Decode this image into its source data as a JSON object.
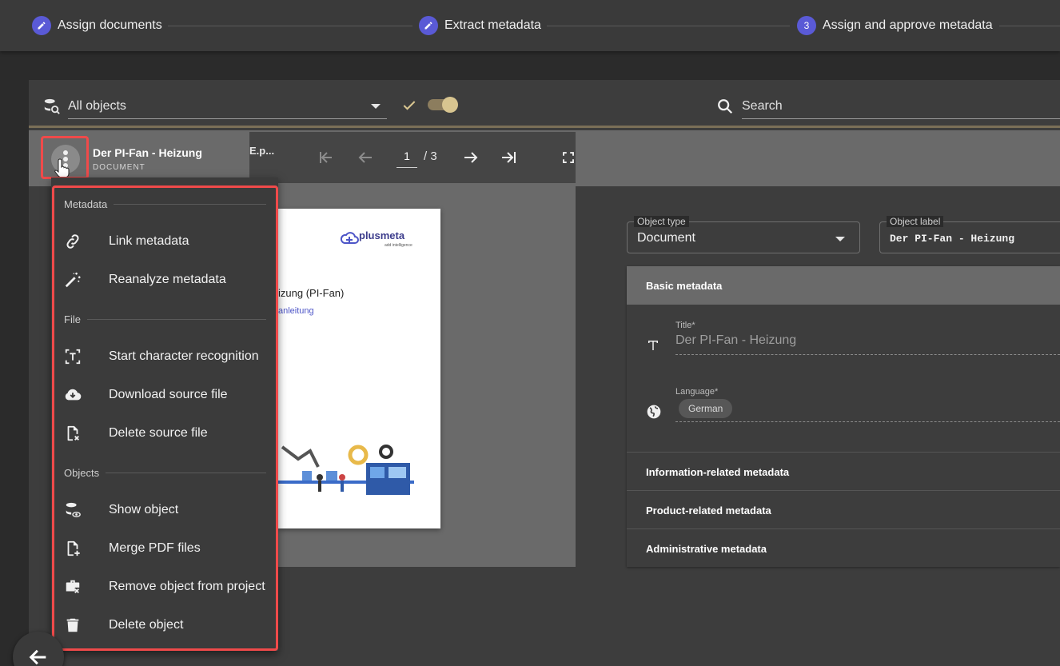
{
  "stepper": {
    "steps": [
      {
        "label": "Assign documents",
        "icon": "pencil-icon"
      },
      {
        "label": "Extract metadata",
        "icon": "pencil-icon"
      },
      {
        "label": "Assign and approve metadata",
        "number": "3"
      }
    ]
  },
  "toolbar": {
    "object_filter": "All objects",
    "search_placeholder": "Search"
  },
  "document": {
    "title": "Der PI-Fan - Heizung",
    "type": "DOCUMENT"
  },
  "pdf_viewer": {
    "file_name": "E.p...",
    "current_page": "1",
    "total_pages": "/ 3",
    "page_content": {
      "brand": "plusmeta",
      "brand_sub": "add intelligence",
      "heading": "izung (PI-Fan)",
      "subheading": "anleitung"
    }
  },
  "metadata_form": {
    "object_type_label": "Object type",
    "object_type_value": "Document",
    "object_label_label": "Object label",
    "object_label_value": "Der PI-Fan - Heizung",
    "sections": {
      "basic": "Basic metadata",
      "information": "Information-related metadata",
      "product": "Product-related metadata",
      "administrative": "Administrative metadata"
    },
    "title_label": "Title*",
    "title_value": "Der PI-Fan - Heizung",
    "language_label": "Language*",
    "language_value": "German"
  },
  "context_menu": {
    "sections": {
      "metadata": "Metadata",
      "file": "File",
      "objects": "Objects"
    },
    "items": [
      {
        "label": "Link metadata",
        "icon": "link-icon"
      },
      {
        "label": "Reanalyze metadata",
        "icon": "magic-wand-icon"
      },
      {
        "label": "Start character recognition",
        "icon": "text-recognition-icon"
      },
      {
        "label": "Download source file",
        "icon": "cloud-download-icon"
      },
      {
        "label": "Delete source file",
        "icon": "file-delete-icon"
      },
      {
        "label": "Show object",
        "icon": "database-eye-icon"
      },
      {
        "label": "Merge PDF files",
        "icon": "file-plus-icon"
      },
      {
        "label": "Remove object from project",
        "icon": "briefcase-remove-icon"
      },
      {
        "label": "Delete object",
        "icon": "trash-icon"
      }
    ]
  },
  "colors": {
    "accent": "#5a5ad6",
    "highlight": "#f04a4a",
    "toggle": "#d8c590"
  }
}
